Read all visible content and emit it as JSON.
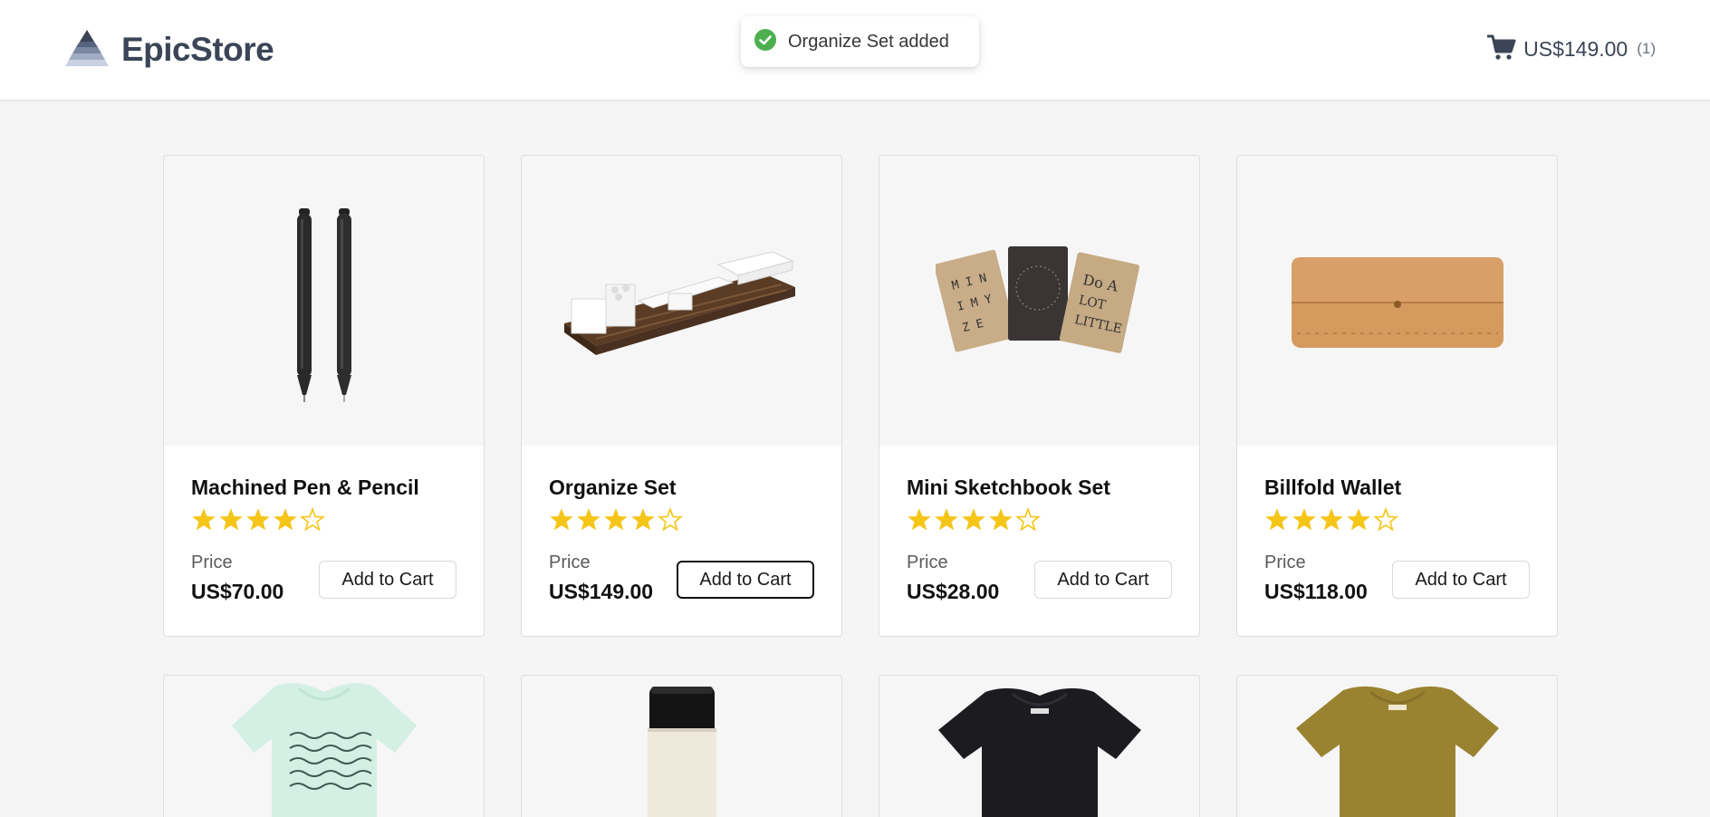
{
  "header": {
    "brand": "EpicStore",
    "cart_total": "US$149.00",
    "cart_count": "(1)"
  },
  "toast": {
    "message": "Organize Set added",
    "icon": "check-circle-icon",
    "color": "#4caf50"
  },
  "colors": {
    "star": "#f5c518",
    "brand_text": "#3b4557"
  },
  "products": [
    {
      "name": "Machined Pen & Pencil",
      "rating": 4,
      "max_rating": 5,
      "price_label": "Price",
      "price": "US$70.00",
      "button": "Add to Cart"
    },
    {
      "name": "Organize Set",
      "rating": 4,
      "max_rating": 5,
      "price_label": "Price",
      "price": "US$149.00",
      "button": "Add to Cart"
    },
    {
      "name": "Mini Sketchbook Set",
      "rating": 4,
      "max_rating": 5,
      "price_label": "Price",
      "price": "US$28.00",
      "button": "Add to Cart"
    },
    {
      "name": "Billfold Wallet",
      "rating": 4,
      "max_rating": 5,
      "price_label": "Price",
      "price": "US$118.00",
      "button": "Add to Cart"
    }
  ],
  "second_row_images": [
    "mint-wave-tshirt",
    "thermos-bottle",
    "black-tshirt",
    "olive-tshirt"
  ]
}
